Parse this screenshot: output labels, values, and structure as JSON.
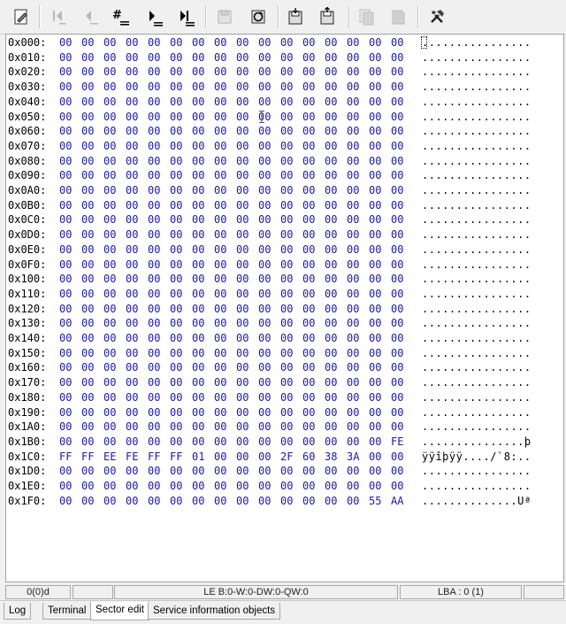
{
  "toolbar": {
    "buttons": [
      {
        "name": "sector-edit-icon",
        "enabled": true
      },
      {
        "name": "first-sector-icon",
        "enabled": false
      },
      {
        "name": "previous-sector-icon",
        "enabled": false
      },
      {
        "name": "goto-sector-icon",
        "enabled": true
      },
      {
        "name": "next-sector-icon",
        "enabled": true
      },
      {
        "name": "last-sector-icon",
        "enabled": true
      },
      {
        "name": "save-sector-icon",
        "enabled": false
      },
      {
        "name": "refresh-sector-icon",
        "enabled": true
      },
      {
        "name": "save-to-file-icon",
        "enabled": true
      },
      {
        "name": "load-from-file-icon",
        "enabled": true
      },
      {
        "name": "copy-icon",
        "enabled": false
      },
      {
        "name": "paste-icon",
        "enabled": false
      },
      {
        "name": "tools-icon",
        "enabled": true
      }
    ]
  },
  "hex": {
    "rows": [
      {
        "offset": "0x000:",
        "bytes": [
          "00",
          "00",
          "00",
          "00",
          "00",
          "00",
          "00",
          "00",
          "00",
          "00",
          "00",
          "00",
          "00",
          "00",
          "00",
          "00"
        ],
        "ascii": "................"
      },
      {
        "offset": "0x010:",
        "bytes": [
          "00",
          "00",
          "00",
          "00",
          "00",
          "00",
          "00",
          "00",
          "00",
          "00",
          "00",
          "00",
          "00",
          "00",
          "00",
          "00"
        ],
        "ascii": "................"
      },
      {
        "offset": "0x020:",
        "bytes": [
          "00",
          "00",
          "00",
          "00",
          "00",
          "00",
          "00",
          "00",
          "00",
          "00",
          "00",
          "00",
          "00",
          "00",
          "00",
          "00"
        ],
        "ascii": "................"
      },
      {
        "offset": "0x030:",
        "bytes": [
          "00",
          "00",
          "00",
          "00",
          "00",
          "00",
          "00",
          "00",
          "00",
          "00",
          "00",
          "00",
          "00",
          "00",
          "00",
          "00"
        ],
        "ascii": "................"
      },
      {
        "offset": "0x040:",
        "bytes": [
          "00",
          "00",
          "00",
          "00",
          "00",
          "00",
          "00",
          "00",
          "00",
          "00",
          "00",
          "00",
          "00",
          "00",
          "00",
          "00"
        ],
        "ascii": "................"
      },
      {
        "offset": "0x050:",
        "bytes": [
          "00",
          "00",
          "00",
          "00",
          "00",
          "00",
          "00",
          "00",
          "00",
          "00",
          "00",
          "00",
          "00",
          "00",
          "00",
          "00"
        ],
        "ascii": "................"
      },
      {
        "offset": "0x060:",
        "bytes": [
          "00",
          "00",
          "00",
          "00",
          "00",
          "00",
          "00",
          "00",
          "00",
          "00",
          "00",
          "00",
          "00",
          "00",
          "00",
          "00"
        ],
        "ascii": "................"
      },
      {
        "offset": "0x070:",
        "bytes": [
          "00",
          "00",
          "00",
          "00",
          "00",
          "00",
          "00",
          "00",
          "00",
          "00",
          "00",
          "00",
          "00",
          "00",
          "00",
          "00"
        ],
        "ascii": "................"
      },
      {
        "offset": "0x080:",
        "bytes": [
          "00",
          "00",
          "00",
          "00",
          "00",
          "00",
          "00",
          "00",
          "00",
          "00",
          "00",
          "00",
          "00",
          "00",
          "00",
          "00"
        ],
        "ascii": "................"
      },
      {
        "offset": "0x090:",
        "bytes": [
          "00",
          "00",
          "00",
          "00",
          "00",
          "00",
          "00",
          "00",
          "00",
          "00",
          "00",
          "00",
          "00",
          "00",
          "00",
          "00"
        ],
        "ascii": "................"
      },
      {
        "offset": "0x0A0:",
        "bytes": [
          "00",
          "00",
          "00",
          "00",
          "00",
          "00",
          "00",
          "00",
          "00",
          "00",
          "00",
          "00",
          "00",
          "00",
          "00",
          "00"
        ],
        "ascii": "................"
      },
      {
        "offset": "0x0B0:",
        "bytes": [
          "00",
          "00",
          "00",
          "00",
          "00",
          "00",
          "00",
          "00",
          "00",
          "00",
          "00",
          "00",
          "00",
          "00",
          "00",
          "00"
        ],
        "ascii": "................"
      },
      {
        "offset": "0x0C0:",
        "bytes": [
          "00",
          "00",
          "00",
          "00",
          "00",
          "00",
          "00",
          "00",
          "00",
          "00",
          "00",
          "00",
          "00",
          "00",
          "00",
          "00"
        ],
        "ascii": "................"
      },
      {
        "offset": "0x0D0:",
        "bytes": [
          "00",
          "00",
          "00",
          "00",
          "00",
          "00",
          "00",
          "00",
          "00",
          "00",
          "00",
          "00",
          "00",
          "00",
          "00",
          "00"
        ],
        "ascii": "................"
      },
      {
        "offset": "0x0E0:",
        "bytes": [
          "00",
          "00",
          "00",
          "00",
          "00",
          "00",
          "00",
          "00",
          "00",
          "00",
          "00",
          "00",
          "00",
          "00",
          "00",
          "00"
        ],
        "ascii": "................"
      },
      {
        "offset": "0x0F0:",
        "bytes": [
          "00",
          "00",
          "00",
          "00",
          "00",
          "00",
          "00",
          "00",
          "00",
          "00",
          "00",
          "00",
          "00",
          "00",
          "00",
          "00"
        ],
        "ascii": "................"
      },
      {
        "offset": "0x100:",
        "bytes": [
          "00",
          "00",
          "00",
          "00",
          "00",
          "00",
          "00",
          "00",
          "00",
          "00",
          "00",
          "00",
          "00",
          "00",
          "00",
          "00"
        ],
        "ascii": "................"
      },
      {
        "offset": "0x110:",
        "bytes": [
          "00",
          "00",
          "00",
          "00",
          "00",
          "00",
          "00",
          "00",
          "00",
          "00",
          "00",
          "00",
          "00",
          "00",
          "00",
          "00"
        ],
        "ascii": "................"
      },
      {
        "offset": "0x120:",
        "bytes": [
          "00",
          "00",
          "00",
          "00",
          "00",
          "00",
          "00",
          "00",
          "00",
          "00",
          "00",
          "00",
          "00",
          "00",
          "00",
          "00"
        ],
        "ascii": "................"
      },
      {
        "offset": "0x130:",
        "bytes": [
          "00",
          "00",
          "00",
          "00",
          "00",
          "00",
          "00",
          "00",
          "00",
          "00",
          "00",
          "00",
          "00",
          "00",
          "00",
          "00"
        ],
        "ascii": "................"
      },
      {
        "offset": "0x140:",
        "bytes": [
          "00",
          "00",
          "00",
          "00",
          "00",
          "00",
          "00",
          "00",
          "00",
          "00",
          "00",
          "00",
          "00",
          "00",
          "00",
          "00"
        ],
        "ascii": "................"
      },
      {
        "offset": "0x150:",
        "bytes": [
          "00",
          "00",
          "00",
          "00",
          "00",
          "00",
          "00",
          "00",
          "00",
          "00",
          "00",
          "00",
          "00",
          "00",
          "00",
          "00"
        ],
        "ascii": "................"
      },
      {
        "offset": "0x160:",
        "bytes": [
          "00",
          "00",
          "00",
          "00",
          "00",
          "00",
          "00",
          "00",
          "00",
          "00",
          "00",
          "00",
          "00",
          "00",
          "00",
          "00"
        ],
        "ascii": "................"
      },
      {
        "offset": "0x170:",
        "bytes": [
          "00",
          "00",
          "00",
          "00",
          "00",
          "00",
          "00",
          "00",
          "00",
          "00",
          "00",
          "00",
          "00",
          "00",
          "00",
          "00"
        ],
        "ascii": "................"
      },
      {
        "offset": "0x180:",
        "bytes": [
          "00",
          "00",
          "00",
          "00",
          "00",
          "00",
          "00",
          "00",
          "00",
          "00",
          "00",
          "00",
          "00",
          "00",
          "00",
          "00"
        ],
        "ascii": "................"
      },
      {
        "offset": "0x190:",
        "bytes": [
          "00",
          "00",
          "00",
          "00",
          "00",
          "00",
          "00",
          "00",
          "00",
          "00",
          "00",
          "00",
          "00",
          "00",
          "00",
          "00"
        ],
        "ascii": "................"
      },
      {
        "offset": "0x1A0:",
        "bytes": [
          "00",
          "00",
          "00",
          "00",
          "00",
          "00",
          "00",
          "00",
          "00",
          "00",
          "00",
          "00",
          "00",
          "00",
          "00",
          "00"
        ],
        "ascii": "................"
      },
      {
        "offset": "0x1B0:",
        "bytes": [
          "00",
          "00",
          "00",
          "00",
          "00",
          "00",
          "00",
          "00",
          "00",
          "00",
          "00",
          "00",
          "00",
          "00",
          "00",
          "FE"
        ],
        "ascii": "...............þ"
      },
      {
        "offset": "0x1C0:",
        "bytes": [
          "FF",
          "FF",
          "EE",
          "FE",
          "FF",
          "FF",
          "01",
          "00",
          "00",
          "00",
          "2F",
          "60",
          "38",
          "3A",
          "00",
          "00"
        ],
        "ascii": "ÿÿîþÿÿ..../`8:.."
      },
      {
        "offset": "0x1D0:",
        "bytes": [
          "00",
          "00",
          "00",
          "00",
          "00",
          "00",
          "00",
          "00",
          "00",
          "00",
          "00",
          "00",
          "00",
          "00",
          "00",
          "00"
        ],
        "ascii": "................"
      },
      {
        "offset": "0x1E0:",
        "bytes": [
          "00",
          "00",
          "00",
          "00",
          "00",
          "00",
          "00",
          "00",
          "00",
          "00",
          "00",
          "00",
          "00",
          "00",
          "00",
          "00"
        ],
        "ascii": "................"
      },
      {
        "offset": "0x1F0:",
        "bytes": [
          "00",
          "00",
          "00",
          "00",
          "00",
          "00",
          "00",
          "00",
          "00",
          "00",
          "00",
          "00",
          "00",
          "00",
          "55",
          "AA"
        ],
        "ascii": "..............Uª"
      }
    ]
  },
  "status": {
    "position": "0(0)d",
    "values": "LE B:0-W:0-DW:0-QW:0",
    "lba": "LBA : 0 (1)"
  },
  "tabs": [
    {
      "label": "Log",
      "active": false
    },
    {
      "label": "Terminal",
      "active": false
    },
    {
      "label": "Sector edit",
      "active": true
    },
    {
      "label": "Service information objects",
      "active": false
    }
  ],
  "colors": {
    "hex_byte": "#1a1aaa",
    "offset": "#000000",
    "background": "#ffffff",
    "chrome": "#f0f0f0"
  }
}
